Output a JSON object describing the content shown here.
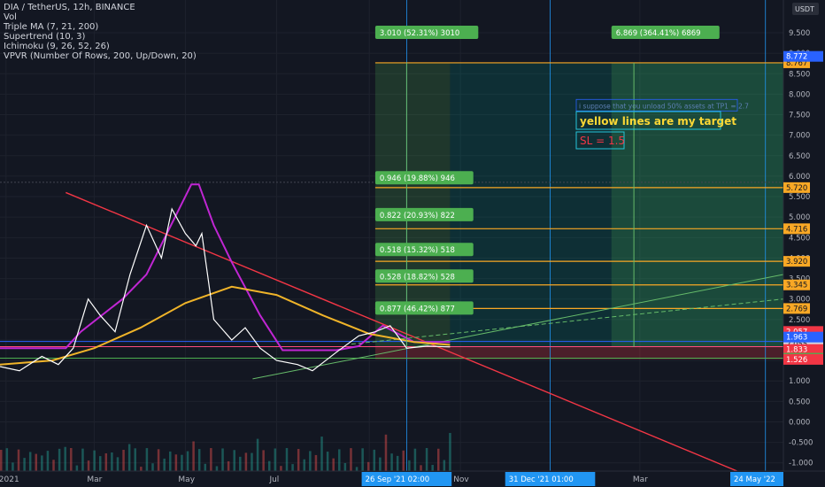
{
  "header": {
    "symbol": "DIA / TetherUS, 12h, BINANCE",
    "indicators": [
      "Vol",
      "Triple MA (7, 21, 200)",
      "Supertrend (10, 3)",
      "Ichimoku (9, 26, 52, 26)",
      "VPVR (Number Of Rows, 200, Up/Down, 20)"
    ]
  },
  "chart_data": {
    "type": "line",
    "title": "DIA / TetherUS, 12h, BINANCE",
    "y_axis": {
      "currency": "USDT",
      "ticks": [
        "9.500",
        "9.000",
        "8.500",
        "8.000",
        "7.500",
        "7.000",
        "6.500",
        "6.000",
        "5.500",
        "5.000",
        "4.500",
        "4.000",
        "3.500",
        "3.000",
        "2.500",
        "2.000",
        "1.500",
        "1.000",
        "0.500",
        "0.000",
        "-0.500",
        "-1.000"
      ],
      "range": [
        -1.2,
        10.3
      ]
    },
    "x_axis": {
      "ticks": [
        "2021",
        "Mar",
        "May",
        "Jul",
        "Sep",
        "Nov",
        "Mar"
      ],
      "range": [
        "2020-12-28",
        "2022-06-05"
      ],
      "crosshair_labels": [
        "26 Sep '21   02:00",
        "31 Dec '21   01:00",
        "24 May '22"
      ]
    },
    "price_series": {
      "name": "DIA/USDT",
      "x": [
        "2020-12-28",
        "2021-01-10",
        "2021-01-25",
        "2021-02-05",
        "2021-02-15",
        "2021-02-25",
        "2021-03-05",
        "2021-03-15",
        "2021-03-25",
        "2021-04-05",
        "2021-04-15",
        "2021-04-22",
        "2021-05-01",
        "2021-05-08",
        "2021-05-12",
        "2021-05-20",
        "2021-06-01",
        "2021-06-10",
        "2021-06-20",
        "2021-07-01",
        "2021-07-15",
        "2021-07-25",
        "2021-08-10",
        "2021-08-25",
        "2021-09-05",
        "2021-09-15",
        "2021-09-26",
        "2021-10-10",
        "2021-10-25"
      ],
      "values": [
        1.35,
        1.25,
        1.6,
        1.4,
        1.8,
        3.0,
        2.6,
        2.2,
        3.6,
        4.8,
        4.0,
        5.2,
        4.6,
        4.3,
        4.6,
        2.5,
        2.0,
        2.3,
        1.8,
        1.5,
        1.4,
        1.25,
        1.7,
        2.1,
        2.2,
        2.35,
        1.8,
        1.85,
        1.83
      ]
    },
    "ma200": {
      "name": "MA 200",
      "x": [
        "2020-12-28",
        "2021-02-01",
        "2021-03-01",
        "2021-04-01",
        "2021-05-01",
        "2021-06-01",
        "2021-07-01",
        "2021-08-01",
        "2021-09-01",
        "2021-10-01",
        "2021-10-25"
      ],
      "values": [
        1.4,
        1.5,
        1.8,
        2.3,
        2.9,
        3.3,
        3.1,
        2.6,
        2.15,
        1.95,
        1.88
      ]
    },
    "supertrend": {
      "name": "Supertrend",
      "x": [
        "2020-12-28",
        "2021-02-10",
        "2021-02-20",
        "2021-03-20",
        "2021-04-05",
        "2021-05-05",
        "2021-05-10",
        "2021-05-20",
        "2021-06-01",
        "2021-06-20",
        "2021-07-05",
        "2021-08-10",
        "2021-08-25",
        "2021-09-10",
        "2021-10-01",
        "2021-10-25"
      ],
      "values": [
        1.8,
        1.8,
        2.2,
        3.0,
        3.6,
        5.8,
        5.8,
        4.8,
        3.9,
        2.6,
        1.75,
        1.75,
        1.85,
        2.35,
        1.95,
        1.95
      ]
    },
    "target_levels": [
      {
        "price": 8.767,
        "label": "8.767"
      },
      {
        "price": 5.72,
        "label": "5.720"
      },
      {
        "price": 4.716,
        "label": "4.716"
      },
      {
        "price": 3.92,
        "label": "3.920"
      },
      {
        "price": 3.345,
        "label": "3.345"
      },
      {
        "price": 2.769,
        "label": "2.769"
      }
    ],
    "price_labels": [
      {
        "price": 8.772,
        "label": "8.772",
        "color": "#2962ff"
      },
      {
        "price": 2.057,
        "label": "2.057",
        "color": "#f23645"
      },
      {
        "price": 2.055,
        "label": "2.055",
        "color": "#d1d4dc"
      },
      {
        "price": 1.963,
        "label": "1.963",
        "color": "#2962ff"
      },
      {
        "price": 1.836,
        "label": "1.836",
        "color": "#ff4d7d"
      },
      {
        "price": 1.833,
        "label": "1.833",
        "sub": "10:41:25",
        "color": "#f23645"
      },
      {
        "price": 1.555,
        "label": "1.555",
        "color": "#4caf50"
      },
      {
        "price": 1.526,
        "label": "1.526",
        "color": "#f23645"
      }
    ],
    "measure_labels": [
      {
        "text": "3.010 (52.31%) 3010",
        "price": 9.5,
        "date": "2021-09-05"
      },
      {
        "text": "6.869 (364.41%) 6869",
        "price": 9.5,
        "date": "2022-02-10"
      },
      {
        "text": "0.946 (19.88%) 946",
        "price": 5.95,
        "date": "2021-09-05"
      },
      {
        "text": "0.822 (20.93%) 822",
        "price": 5.05,
        "date": "2021-09-05"
      },
      {
        "text": "0.518 (15.32%) 518",
        "price": 4.2,
        "date": "2021-09-05"
      },
      {
        "text": "0.528 (18.82%) 528",
        "price": 3.55,
        "date": "2021-09-05"
      },
      {
        "text": "0.877 (46.42%) 877",
        "price": 2.77,
        "date": "2021-09-05"
      }
    ],
    "notes": [
      "i suppose that you unload 50% assets at TP1 = 2.7",
      "yellow lines are my target",
      "SL = 1.5"
    ],
    "colors": {
      "target_line": "#f9a825",
      "label_green": "#4caf50",
      "downtrend": "#f23645",
      "ma200": "#f0b429",
      "supertrend": "#c026d3",
      "price": "#ffffff",
      "background": "#131722",
      "grid": "#1e222d"
    }
  }
}
